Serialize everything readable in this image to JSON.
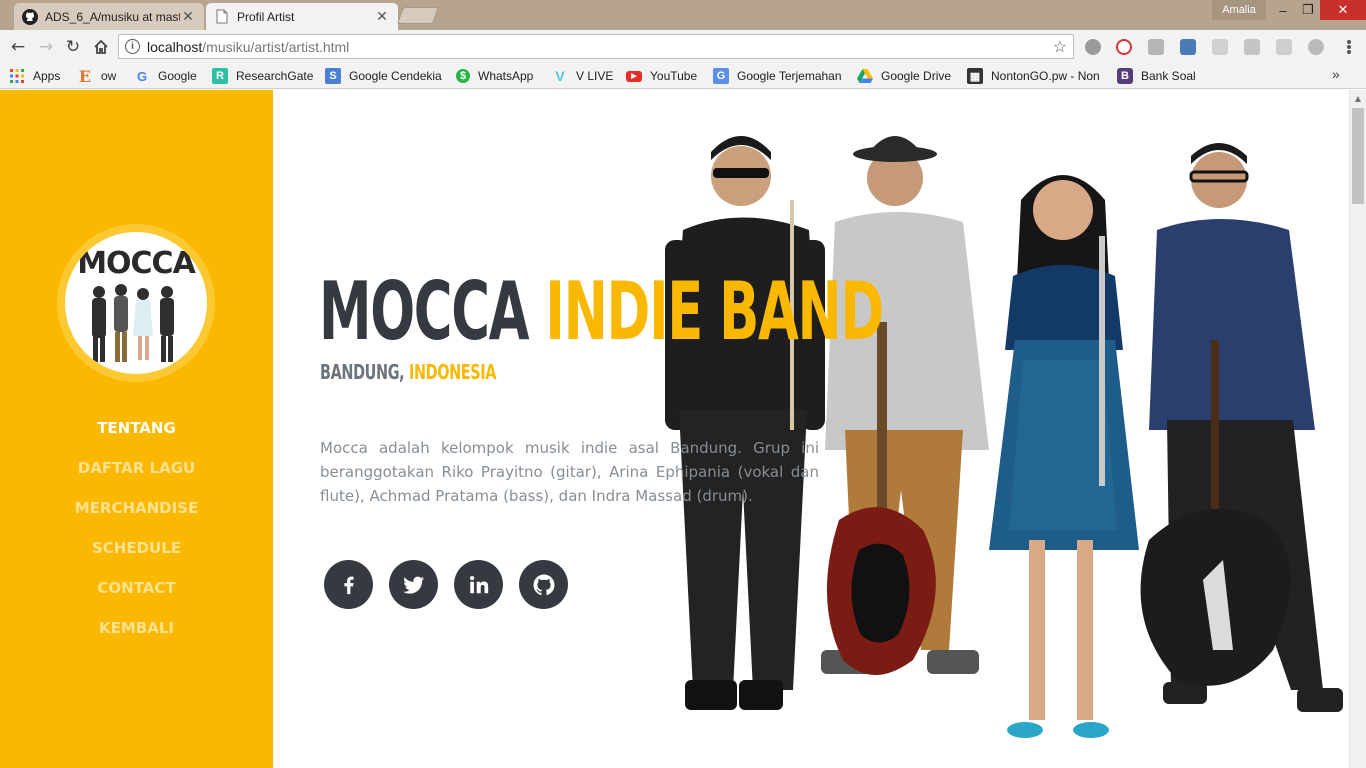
{
  "browser": {
    "tabs": [
      {
        "title": "ADS_6_A/musiku at mast",
        "icon": "github-icon",
        "active": false
      },
      {
        "title": "Profil Artist",
        "icon": "page-icon",
        "active": true
      }
    ],
    "profile": "Amalia",
    "url_host": "localhost",
    "url_path": "/musiku/artist/artist.html",
    "bookmarks": [
      {
        "label": "Apps",
        "icon": "apps-grid-icon"
      },
      {
        "label": "ow",
        "icon": "e-icon",
        "glyph": "E",
        "color": "#e8742c"
      },
      {
        "label": "Google",
        "icon": "google-icon",
        "glyph": "G",
        "color": "#4285f4"
      },
      {
        "label": "ResearchGate",
        "icon": "researchgate-icon",
        "glyph": "R",
        "color": "#2fbfa4"
      },
      {
        "label": "Google Cendekia",
        "icon": "scholar-icon",
        "glyph": "S",
        "color": "#4a7fd4"
      },
      {
        "label": "WhatsApp",
        "icon": "whatsapp-icon",
        "glyph": "$",
        "color": "#25b544"
      },
      {
        "label": "V LIVE",
        "icon": "vlive-icon",
        "glyph": "V",
        "color": "#53c5e0"
      },
      {
        "label": "YouTube",
        "icon": "youtube-icon",
        "glyph": "▶",
        "color": "#e52d27"
      },
      {
        "label": "Google Terjemahan",
        "icon": "translate-icon",
        "glyph": "G",
        "color": "#5b8fe8"
      },
      {
        "label": "Google Drive",
        "icon": "drive-icon",
        "glyph": "▲",
        "color": "#1fa463"
      },
      {
        "label": "NontonGO.pw - Non",
        "icon": "film-icon",
        "glyph": "▦",
        "color": "#333333"
      },
      {
        "label": "Bank Soal",
        "icon": "bootstrap-icon",
        "glyph": "B",
        "color": "#563d7c"
      }
    ]
  },
  "sidebar": {
    "logo_text": "MOCCA",
    "nav": [
      {
        "label": "TENTANG",
        "active": true
      },
      {
        "label": "DAFTAR LAGU",
        "active": false
      },
      {
        "label": "MERCHANDISE",
        "active": false
      },
      {
        "label": "SCHEDULE",
        "active": false
      },
      {
        "label": "CONTACT",
        "active": false
      },
      {
        "label": "KEMBALI",
        "active": false
      }
    ]
  },
  "hero": {
    "title_dark": "MOCCA",
    "title_accent": "INDIE BAND",
    "city": "BANDUNG,",
    "country": "INDONESIA",
    "bio": "Mocca adalah kelompok musik indie asal Bandung. Grup ini beranggotakan Riko Prayitno (gitar), Arina Ephipania (vokal dan flute), Achmad Pratama (bass), dan Indra Massad (drum).",
    "social": [
      "facebook-icon",
      "twitter-icon",
      "linkedin-icon",
      "github-icon"
    ]
  },
  "colors": {
    "accent": "#fbb800",
    "dark": "#343a40",
    "muted": "#868e96"
  }
}
